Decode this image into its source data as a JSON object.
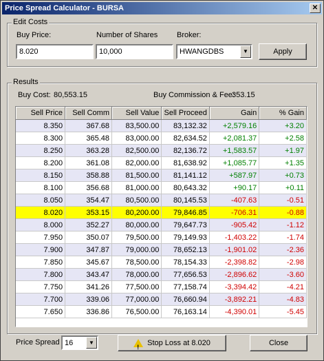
{
  "title": "Price Spread Calculator - BURSA",
  "edit_costs": {
    "legend": "Edit Costs",
    "buy_price_label": "Buy Price:",
    "buy_price_value": "8.020",
    "shares_label": "Number of Shares",
    "shares_value": "10,000",
    "broker_label": "Broker:",
    "broker_value": "HWANGDBS",
    "apply_label": "Apply"
  },
  "results": {
    "legend": "Results",
    "buy_cost_label": "Buy Cost:",
    "buy_cost_value": "80,553.15",
    "commission_label": "Buy Commission & Fee:",
    "commission_value": "353.15",
    "columns": [
      "Sell Price",
      "Sell Comm",
      "Sell Value",
      "Sell Proceed",
      "Gain",
      "% Gain"
    ],
    "rows": [
      {
        "price": "8.350",
        "comm": "367.68",
        "value": "83,500.00",
        "proceed": "83,132.32",
        "gain": "+2,579.16",
        "pct": "+3.20"
      },
      {
        "price": "8.300",
        "comm": "365.48",
        "value": "83,000.00",
        "proceed": "82,634.52",
        "gain": "+2,081.37",
        "pct": "+2.58"
      },
      {
        "price": "8.250",
        "comm": "363.28",
        "value": "82,500.00",
        "proceed": "82,136.72",
        "gain": "+1,583.57",
        "pct": "+1.97"
      },
      {
        "price": "8.200",
        "comm": "361.08",
        "value": "82,000.00",
        "proceed": "81,638.92",
        "gain": "+1,085.77",
        "pct": "+1.35"
      },
      {
        "price": "8.150",
        "comm": "358.88",
        "value": "81,500.00",
        "proceed": "81,141.12",
        "gain": "+587.97",
        "pct": "+0.73"
      },
      {
        "price": "8.100",
        "comm": "356.68",
        "value": "81,000.00",
        "proceed": "80,643.32",
        "gain": "+90.17",
        "pct": "+0.11"
      },
      {
        "price": "8.050",
        "comm": "354.47",
        "value": "80,500.00",
        "proceed": "80,145.53",
        "gain": "-407.63",
        "pct": "-0.51"
      },
      {
        "price": "8.020",
        "comm": "353.15",
        "value": "80,200.00",
        "proceed": "79,846.85",
        "gain": "-706.31",
        "pct": "-0.88"
      },
      {
        "price": "8.000",
        "comm": "352.27",
        "value": "80,000.00",
        "proceed": "79,647.73",
        "gain": "-905.42",
        "pct": "-1.12"
      },
      {
        "price": "7.950",
        "comm": "350.07",
        "value": "79,500.00",
        "proceed": "79,149.93",
        "gain": "-1,403.22",
        "pct": "-1.74"
      },
      {
        "price": "7.900",
        "comm": "347.87",
        "value": "79,000.00",
        "proceed": "78,652.13",
        "gain": "-1,901.02",
        "pct": "-2.36"
      },
      {
        "price": "7.850",
        "comm": "345.67",
        "value": "78,500.00",
        "proceed": "78,154.33",
        "gain": "-2,398.82",
        "pct": "-2.98"
      },
      {
        "price": "7.800",
        "comm": "343.47",
        "value": "78,000.00",
        "proceed": "77,656.53",
        "gain": "-2,896.62",
        "pct": "-3.60"
      },
      {
        "price": "7.750",
        "comm": "341.26",
        "value": "77,500.00",
        "proceed": "77,158.74",
        "gain": "-3,394.42",
        "pct": "-4.21"
      },
      {
        "price": "7.700",
        "comm": "339.06",
        "value": "77,000.00",
        "proceed": "76,660.94",
        "gain": "-3,892.21",
        "pct": "-4.83"
      },
      {
        "price": "7.650",
        "comm": "336.86",
        "value": "76,500.00",
        "proceed": "76,163.14",
        "gain": "-4,390.01",
        "pct": "-5.45"
      }
    ],
    "highlight_price": "8.020"
  },
  "footer": {
    "spread_label": "Price Spread",
    "spread_value": "16",
    "stop_loss_label": "Stop Loss at 8.020",
    "close_label": "Close"
  },
  "colors": {
    "positive": "#008000",
    "negative": "#d00000",
    "highlight": "#ffff00",
    "alt_row": "#e6e6f5"
  },
  "icons": {
    "stop_loss": "warning-icon",
    "dropdown": "chevron-down-icon"
  }
}
